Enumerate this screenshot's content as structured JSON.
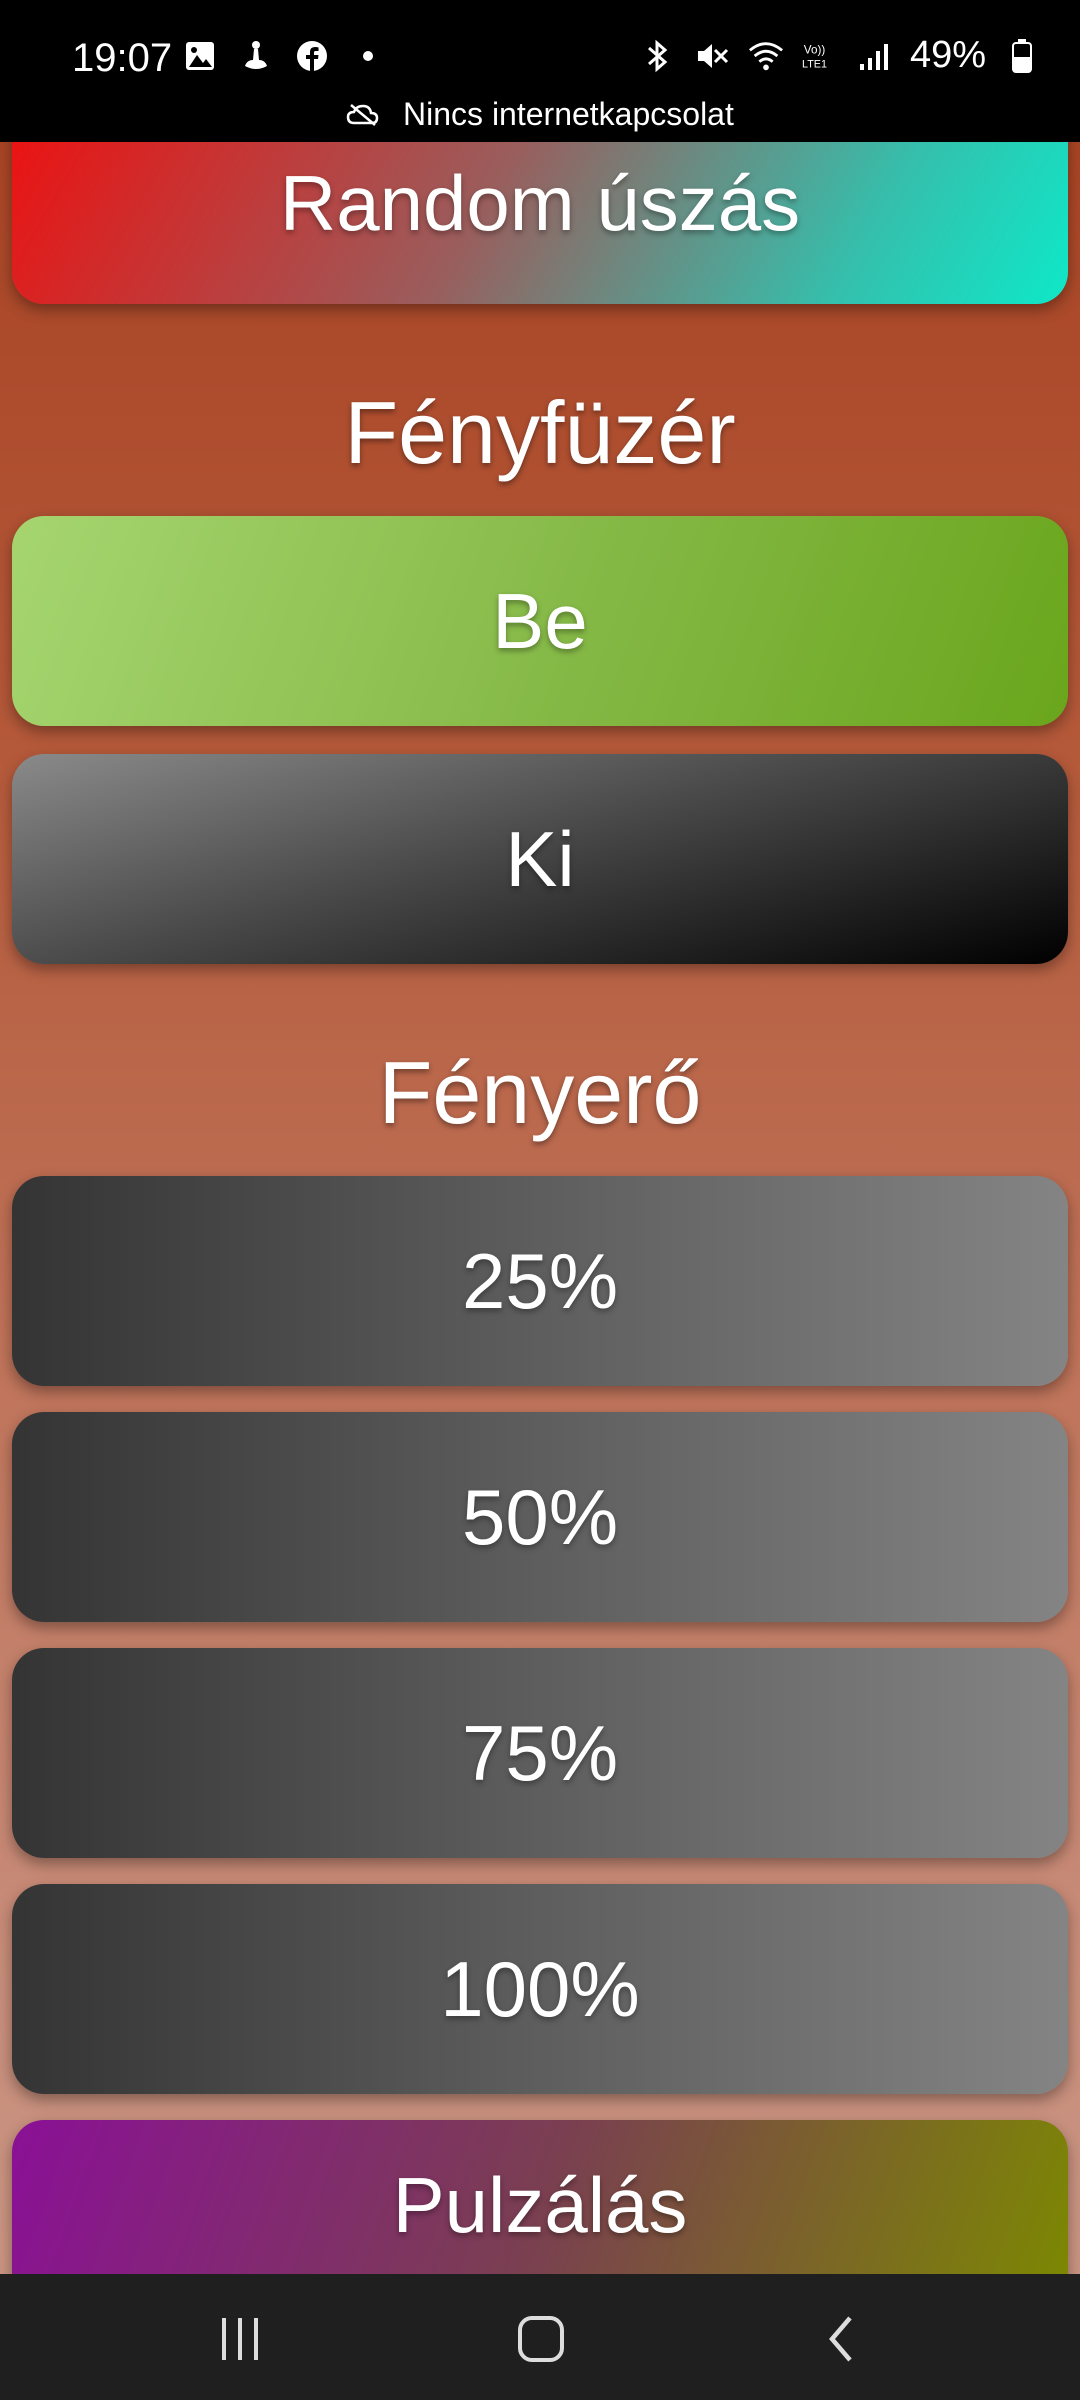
{
  "status_bar": {
    "time": "19:07",
    "battery": "49%",
    "left_icons": [
      "image-icon",
      "anchor-icon",
      "facebook-icon",
      "dot-icon"
    ],
    "right_icons": [
      "bluetooth-icon",
      "mute-icon",
      "wifi-icon",
      "volte-icon",
      "signal-icon",
      "battery-icon"
    ]
  },
  "network_banner": {
    "text": "Nincs internetkapcsolat"
  },
  "buttons": {
    "random": "Random úszás",
    "on": "Be",
    "off": "Ki",
    "p25": "25%",
    "p50": "50%",
    "p75": "75%",
    "p100": "100%",
    "pulse": "Pulzálás"
  },
  "sections": {
    "light_string": "Fényfüzér",
    "brightness": "Fényerő"
  },
  "nav": [
    "recents-icon",
    "home-icon",
    "back-icon"
  ]
}
